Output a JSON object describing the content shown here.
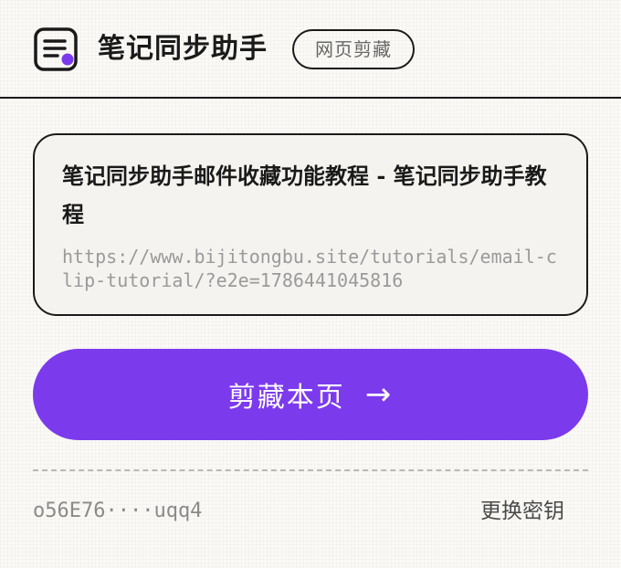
{
  "header": {
    "app_title": "笔记同步助手",
    "mode_badge": "网页剪藏",
    "logo_icon": "notes-list-icon",
    "logo_dot_color": "#7c3aed"
  },
  "page": {
    "title": "笔记同步助手邮件收藏功能教程 - 笔记同步助手教程",
    "url": "https://www.bijitongbu.site/tutorials/email-clip-tutorial/?e2e=1786441045816"
  },
  "actions": {
    "clip_label": "剪藏本页",
    "clip_arrow": "→",
    "clip_color": "#7c3aed"
  },
  "footer": {
    "api_key_masked": "o56E76····uqq4",
    "change_key_label": "更换密钥"
  }
}
